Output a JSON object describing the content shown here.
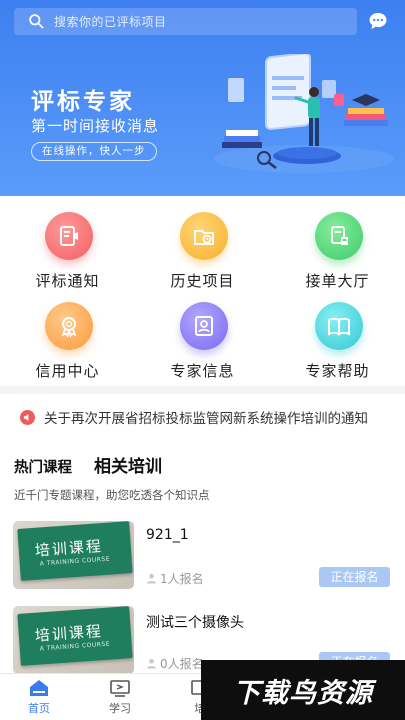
{
  "search": {
    "placeholder": "搜索你的已评标项目"
  },
  "banner": {
    "title": "评标专家",
    "subtitle": "第一时间接收消息",
    "pill": "在线操作，快人一步"
  },
  "menu": [
    {
      "label": "评标通知",
      "icon": "bid-notice-icon",
      "color": "#f35e63"
    },
    {
      "label": "历史项目",
      "icon": "history-project-icon",
      "color": "#f9b02c"
    },
    {
      "label": "接单大厅",
      "icon": "order-hall-icon",
      "color": "#3ecb6a"
    },
    {
      "label": "信用中心",
      "icon": "credit-center-icon",
      "color": "#fb9b3c"
    },
    {
      "label": "专家信息",
      "icon": "expert-info-icon",
      "color": "#7a68ef"
    },
    {
      "label": "专家帮助",
      "icon": "expert-help-icon",
      "color": "#33c8d4"
    }
  ],
  "notice": {
    "text": "关于再次开展省招标投标监管网新系统操作培训的通知"
  },
  "courses": {
    "tab_hot": "热门课程",
    "tab_related": "相关培训",
    "subtitle": "近千门专题课程，助您吃透各个知识点",
    "thumb_title": "培训课程",
    "thumb_sub": "A TRAINING COURSE",
    "items": [
      {
        "name": "921_1",
        "count": "1人报名",
        "status": "正在报名"
      },
      {
        "name": "测试三个摄像头",
        "count": "0人报名",
        "status": "正在报名"
      }
    ]
  },
  "tabbar": [
    {
      "label": "首页",
      "icon": "home-icon",
      "active": true
    },
    {
      "label": "学习",
      "icon": "study-icon",
      "active": false
    },
    {
      "label": "培",
      "icon": "training-icon",
      "active": false
    }
  ],
  "watermark": "下载鸟资源",
  "colors": {
    "primary": "#3d7ff0",
    "button": "#a9c8f3",
    "tab_active": "#3b7de8"
  }
}
